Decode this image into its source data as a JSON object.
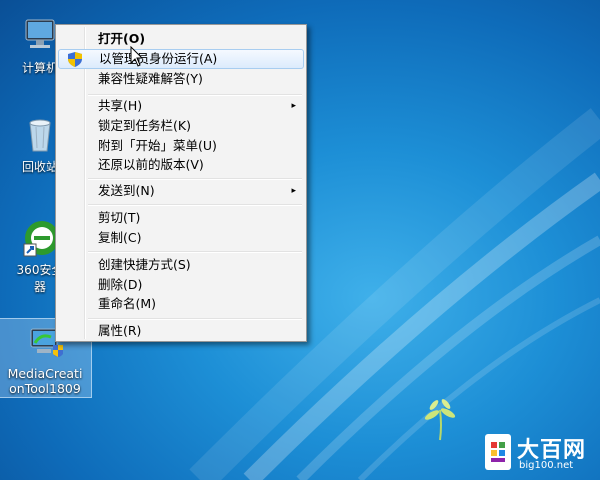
{
  "desktop": {
    "icons": [
      {
        "label": "计算机"
      },
      {
        "label": "回收站"
      },
      {
        "label_line1": "360安全",
        "label_line2": "器"
      },
      {
        "label_line1": "MediaCreati",
        "label_line2": "onTool1809"
      }
    ]
  },
  "context_menu": {
    "items": [
      {
        "label": "打开(O)"
      },
      {
        "label": "以管理员身份运行(A)"
      },
      {
        "label": "兼容性疑难解答(Y)"
      },
      {
        "label": "共享(H)"
      },
      {
        "label": "锁定到任务栏(K)"
      },
      {
        "label": "附到「开始」菜单(U)"
      },
      {
        "label": "还原以前的版本(V)"
      },
      {
        "label": "发送到(N)"
      },
      {
        "label": "剪切(T)"
      },
      {
        "label": "复制(C)"
      },
      {
        "label": "创建快捷方式(S)"
      },
      {
        "label": "删除(D)"
      },
      {
        "label": "重命名(M)"
      },
      {
        "label": "属性(R)"
      }
    ],
    "submenu_arrow": "▸"
  },
  "watermark": {
    "title": "大百网",
    "url": "big100.net"
  }
}
